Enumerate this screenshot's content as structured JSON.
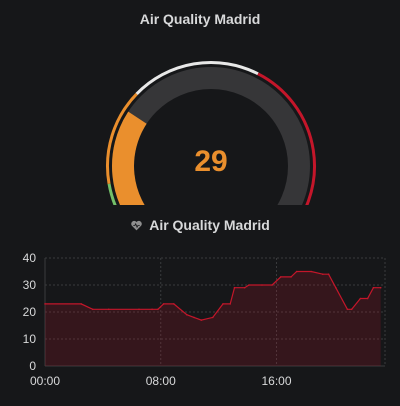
{
  "gauge_panel": {
    "title": "Air Quality Madrid",
    "value": "29"
  },
  "graph_panel": {
    "title": "Air Quality Madrid",
    "title_icon": "heart-icon"
  },
  "colors": {
    "background": "#161719",
    "text": "#d8d9da",
    "good": "#73bf69",
    "moderate": "#ea8f2d",
    "unhealthy": "#e8e8e8",
    "hazardous": "#c4162a",
    "series_line": "#c4162a"
  },
  "chart_data": [
    {
      "type": "gauge",
      "title": "Air Quality Madrid",
      "value": 29,
      "min": 0,
      "max": 100,
      "thresholds": [
        {
          "from": 0,
          "to": 13,
          "color": "#73bf69"
        },
        {
          "from": 13,
          "to": 33,
          "color": "#ea8f2d"
        },
        {
          "from": 33,
          "to": 60,
          "color": "#e8e8e8"
        },
        {
          "from": 60,
          "to": 100,
          "color": "#c4162a"
        }
      ]
    },
    {
      "type": "area",
      "title": "Air Quality Madrid",
      "ylim": [
        0,
        40
      ],
      "yticks": [
        0,
        10,
        20,
        30,
        40
      ],
      "xlim": [
        0,
        23.5
      ],
      "xticks": [
        {
          "value": 0,
          "label": "00:00"
        },
        {
          "value": 8,
          "label": "08:00"
        },
        {
          "value": 16,
          "label": "16:00"
        }
      ],
      "grid": true,
      "series": [
        {
          "x": [
            0,
            2.5,
            3.3,
            4.4,
            6.5,
            7.4,
            7.8,
            8.2,
            8.9,
            9.8,
            10.3,
            10.8,
            11.6,
            12.3,
            12.8,
            13.1,
            13.8,
            14.1,
            15.0,
            15.7,
            16.3,
            17.0,
            17.4,
            18.4,
            19.2,
            19.6,
            20.1,
            20.9,
            21.2,
            21.8,
            22.3,
            22.7,
            23.2
          ],
          "y": [
            23,
            23,
            21,
            21,
            21,
            21,
            21,
            23,
            23,
            19,
            18,
            17,
            18,
            23,
            23,
            29,
            29,
            30,
            30,
            30,
            33,
            33,
            35,
            35,
            34,
            34,
            29,
            21,
            21,
            25,
            25,
            29,
            29
          ]
        }
      ]
    }
  ]
}
